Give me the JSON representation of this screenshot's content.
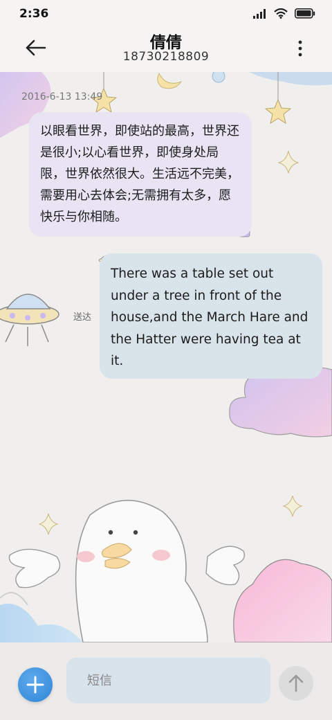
{
  "status": {
    "time": "2:36"
  },
  "header": {
    "title": "倩倩",
    "subtitle": "18730218809"
  },
  "chat": {
    "timestamp": "2016-6-13 13:49",
    "incoming": "以眼看世界，即使站的最高，世界还是很小;以心看世界，即使身处局限，世界依然很大。生活远不完美，需要用心去体会;无需拥有太多，愿快乐与你相随。",
    "outgoing": "There was a table set out under a tree in front of the house,and the March Hare and the Hatter were having tea at it.",
    "delivered_label": "送达"
  },
  "input": {
    "placeholder": "短信"
  },
  "icons": {
    "back": "arrow-left-icon",
    "more": "more-vertical-icon",
    "add": "plus-icon",
    "send": "arrow-up-icon",
    "signal": "signal-icon",
    "wifi": "wifi-icon",
    "battery": "battery-icon"
  },
  "colors": {
    "incoming_bubble": "#e9e4f3",
    "outgoing_bubble": "#d8e3ea",
    "accent": "#2f86d6"
  }
}
